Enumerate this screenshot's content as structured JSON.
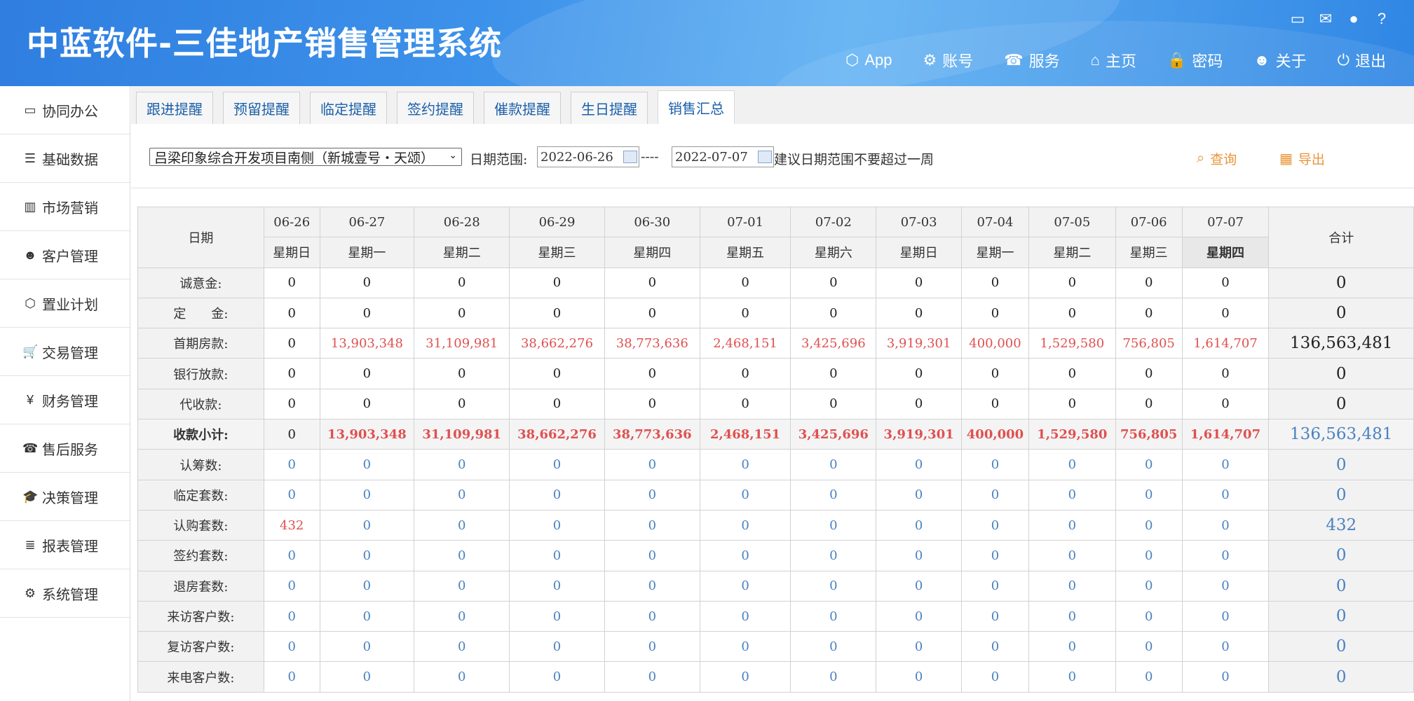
{
  "app": {
    "title": "中蓝软件-三佳地产销售管理系统"
  },
  "top_icons": [
    "laptop-icon",
    "chat-icon",
    "user-icon",
    "help-icon"
  ],
  "top_nav": [
    {
      "label": "App",
      "icon": "cube-icon",
      "glyph": "⬡"
    },
    {
      "label": "账号",
      "icon": "gears-icon",
      "glyph": "⚙"
    },
    {
      "label": "服务",
      "icon": "phone-icon",
      "glyph": "☎"
    },
    {
      "label": "主页",
      "icon": "home-icon",
      "glyph": "⌂"
    },
    {
      "label": "密码",
      "icon": "lock-icon",
      "glyph": "🔒"
    },
    {
      "label": "关于",
      "icon": "users-icon",
      "glyph": "☻"
    },
    {
      "label": "退出",
      "icon": "power-icon",
      "glyph": "⏻"
    }
  ],
  "sidebar": {
    "items": [
      {
        "label": "协同办公",
        "icon": "laptop-icon",
        "glyph": "▭"
      },
      {
        "label": "基础数据",
        "icon": "database-icon",
        "glyph": "☰"
      },
      {
        "label": "市场营销",
        "icon": "bar-chart-icon",
        "glyph": "▥"
      },
      {
        "label": "客户管理",
        "icon": "users-icon",
        "glyph": "☻"
      },
      {
        "label": "置业计划",
        "icon": "cube-icon",
        "glyph": "⬡"
      },
      {
        "label": "交易管理",
        "icon": "cart-icon",
        "glyph": "🛒"
      },
      {
        "label": "财务管理",
        "icon": "yen-icon",
        "glyph": "¥"
      },
      {
        "label": "售后服务",
        "icon": "phone-icon",
        "glyph": "☎"
      },
      {
        "label": "决策管理",
        "icon": "graduation-cap-icon",
        "glyph": "🎓"
      },
      {
        "label": "报表管理",
        "icon": "list-icon",
        "glyph": "≣"
      },
      {
        "label": "系统管理",
        "icon": "gears-icon",
        "glyph": "⚙"
      }
    ]
  },
  "tabs": [
    {
      "label": "跟进提醒",
      "active": false
    },
    {
      "label": "预留提醒",
      "active": false
    },
    {
      "label": "临定提醒",
      "active": false
    },
    {
      "label": "签约提醒",
      "active": false
    },
    {
      "label": "催款提醒",
      "active": false
    },
    {
      "label": "生日提醒",
      "active": false
    },
    {
      "label": "销售汇总",
      "active": true
    }
  ],
  "filters": {
    "project_value": "吕梁印象综合开发项目南侧（新城壹号・天颂）",
    "date_range_label": "日期范围:",
    "start_date": "2022-06-26",
    "separator": "----",
    "end_date": "2022-07-07",
    "hint": "建议日期范围不要超过一周",
    "query_label": "查询",
    "export_label": "导出"
  },
  "table": {
    "date_header": "日期",
    "total_header": "合计",
    "dates": [
      "06-26",
      "06-27",
      "06-28",
      "06-29",
      "06-30",
      "07-01",
      "07-02",
      "07-03",
      "07-04",
      "07-05",
      "07-06",
      "07-07"
    ],
    "weekdays": [
      "星期日",
      "星期一",
      "星期二",
      "星期三",
      "星期四",
      "星期五",
      "星期六",
      "星期日",
      "星期一",
      "星期二",
      "星期三",
      "星期四"
    ],
    "rows": [
      {
        "label": "诚意金:",
        "values": [
          "0",
          "0",
          "0",
          "0",
          "0",
          "0",
          "0",
          "0",
          "0",
          "0",
          "0",
          "0"
        ],
        "total": "0",
        "style": "money"
      },
      {
        "label": "定　　金:",
        "values": [
          "0",
          "0",
          "0",
          "0",
          "0",
          "0",
          "0",
          "0",
          "0",
          "0",
          "0",
          "0"
        ],
        "total": "0",
        "style": "money"
      },
      {
        "label": "首期房款:",
        "values": [
          "0",
          "13,903,348",
          "31,109,981",
          "38,662,276",
          "38,773,636",
          "2,468,151",
          "3,425,696",
          "3,919,301",
          "400,000",
          "1,529,580",
          "756,805",
          "1,614,707"
        ],
        "total": "136,563,481",
        "style": "money"
      },
      {
        "label": "银行放款:",
        "values": [
          "0",
          "0",
          "0",
          "0",
          "0",
          "0",
          "0",
          "0",
          "0",
          "0",
          "0",
          "0"
        ],
        "total": "0",
        "style": "money"
      },
      {
        "label": "代收款:",
        "values": [
          "0",
          "0",
          "0",
          "0",
          "0",
          "0",
          "0",
          "0",
          "0",
          "0",
          "0",
          "0"
        ],
        "total": "0",
        "style": "money"
      },
      {
        "label": "收款小计:",
        "values": [
          "0",
          "13,903,348",
          "31,109,981",
          "38,662,276",
          "38,773,636",
          "2,468,151",
          "3,425,696",
          "3,919,301",
          "400,000",
          "1,529,580",
          "756,805",
          "1,614,707"
        ],
        "total": "136,563,481",
        "style": "subtotal"
      },
      {
        "label": "认筹数:",
        "values": [
          "0",
          "0",
          "0",
          "0",
          "0",
          "0",
          "0",
          "0",
          "0",
          "0",
          "0",
          "0"
        ],
        "total": "0",
        "style": "count"
      },
      {
        "label": "临定套数:",
        "values": [
          "0",
          "0",
          "0",
          "0",
          "0",
          "0",
          "0",
          "0",
          "0",
          "0",
          "0",
          "0"
        ],
        "total": "0",
        "style": "count"
      },
      {
        "label": "认购套数:",
        "values": [
          "432",
          "0",
          "0",
          "0",
          "0",
          "0",
          "0",
          "0",
          "0",
          "0",
          "0",
          "0"
        ],
        "total": "432",
        "style": "count"
      },
      {
        "label": "签约套数:",
        "values": [
          "0",
          "0",
          "0",
          "0",
          "0",
          "0",
          "0",
          "0",
          "0",
          "0",
          "0",
          "0"
        ],
        "total": "0",
        "style": "count"
      },
      {
        "label": "退房套数:",
        "values": [
          "0",
          "0",
          "0",
          "0",
          "0",
          "0",
          "0",
          "0",
          "0",
          "0",
          "0",
          "0"
        ],
        "total": "0",
        "style": "count"
      },
      {
        "label": "来访客户数:",
        "values": [
          "0",
          "0",
          "0",
          "0",
          "0",
          "0",
          "0",
          "0",
          "0",
          "0",
          "0",
          "0"
        ],
        "total": "0",
        "style": "count"
      },
      {
        "label": "复访客户数:",
        "values": [
          "0",
          "0",
          "0",
          "0",
          "0",
          "0",
          "0",
          "0",
          "0",
          "0",
          "0",
          "0"
        ],
        "total": "0",
        "style": "count"
      },
      {
        "label": "来电客户数:",
        "values": [
          "0",
          "0",
          "0",
          "0",
          "0",
          "0",
          "0",
          "0",
          "0",
          "0",
          "0",
          "0"
        ],
        "total": "0",
        "style": "count"
      }
    ]
  }
}
